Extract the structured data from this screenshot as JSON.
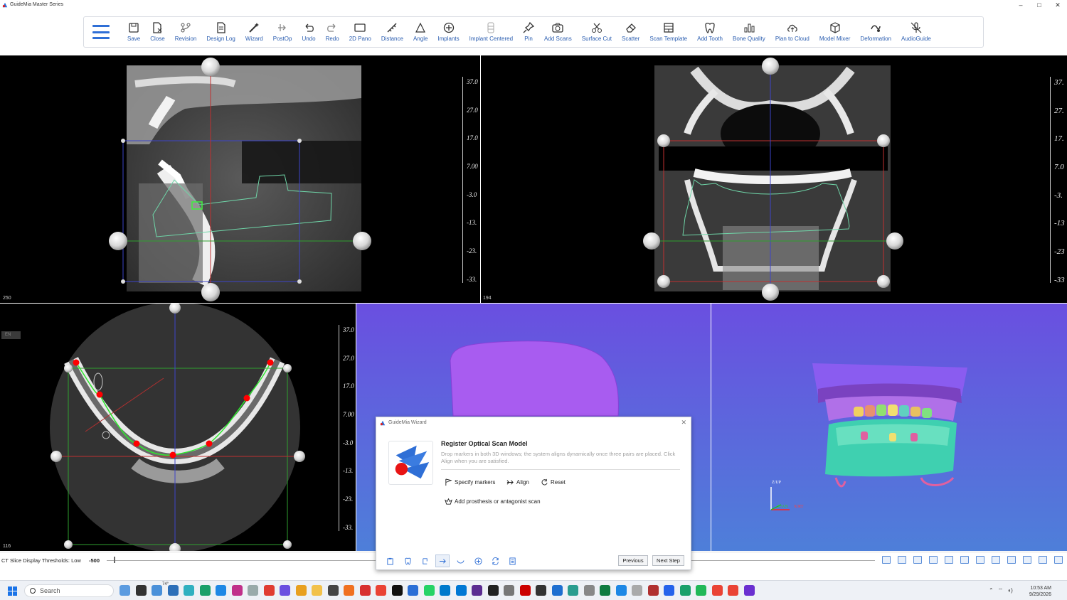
{
  "app": {
    "title": "GuideMia Master Series",
    "window_buttons": [
      "–",
      "□",
      "✕"
    ]
  },
  "toolbar": {
    "items": [
      {
        "label": "Save",
        "icon": "save-icon"
      },
      {
        "label": "Close",
        "icon": "close-file-icon"
      },
      {
        "label": "Revision",
        "icon": "revision-icon"
      },
      {
        "label": "Design Log",
        "icon": "document-icon"
      },
      {
        "label": "Wizard",
        "icon": "wand-icon"
      },
      {
        "label": "PostOp",
        "icon": "postop-icon"
      },
      {
        "label": "Undo",
        "icon": "undo-icon"
      },
      {
        "label": "Redo",
        "icon": "redo-icon"
      },
      {
        "label": "2D Pano",
        "icon": "pano-icon"
      },
      {
        "label": "Distance",
        "icon": "ruler-icon"
      },
      {
        "label": "Angle",
        "icon": "angle-icon"
      },
      {
        "label": "Implants",
        "icon": "implant-icon"
      },
      {
        "label": "Implant Centered",
        "icon": "implant-centered-icon"
      },
      {
        "label": "Pin",
        "icon": "pin-icon"
      },
      {
        "label": "Add Scans",
        "icon": "camera-icon"
      },
      {
        "label": "Surface Cut",
        "icon": "scissors-icon"
      },
      {
        "label": "Scatter",
        "icon": "eraser-icon"
      },
      {
        "label": "Scan Template",
        "icon": "template-icon"
      },
      {
        "label": "Add Tooth",
        "icon": "tooth-icon"
      },
      {
        "label": "Bone Quality",
        "icon": "bar-chart-icon"
      },
      {
        "label": "Plan to Cloud",
        "icon": "cloud-upload-icon"
      },
      {
        "label": "Model Mixer",
        "icon": "cube-icon"
      },
      {
        "label": "Deformation",
        "icon": "deformation-icon"
      },
      {
        "label": "AudioGuide",
        "icon": "mute-mic-icon"
      }
    ]
  },
  "viewports": {
    "sagittal": {
      "slice": "250",
      "ruler": [
        "37.0",
        "27.0",
        "17.0",
        "7.00",
        "-3.0",
        "-13.",
        "-23.",
        "-33."
      ]
    },
    "coronal": {
      "slice": "194",
      "ruler": [
        "37.",
        "27.",
        "17.",
        "7.0",
        "-3.",
        "-13",
        "-23",
        "-33"
      ]
    },
    "axial": {
      "slice": "116",
      "ruler": [
        "37.0",
        "27.0",
        "17.0",
        "7.00",
        "-3.0",
        "-13.",
        "-23.",
        "-33."
      ],
      "side_tag": "EN"
    },
    "model3d": {
      "axis_up": "Z/UP",
      "axis_x": "X/RT",
      "axis_y": "Y/AN"
    }
  },
  "dialog": {
    "window_title": "GuideMia Wizard",
    "heading": "Register Optical Scan Model",
    "description": "Drop markers in both 3D windows; the system aligns dynamically once three pairs are placed. Click Align when you are satisfied.",
    "actions": {
      "specify_markers": "Specify markers",
      "align": "Align",
      "reset": "Reset",
      "add_prosthesis": "Add prosthesis or antagonist scan"
    },
    "buttons": {
      "previous": "Previous",
      "next": "Next Step"
    }
  },
  "threshold_bar": {
    "label": "CT Slice Display Thresholds: Low",
    "low_value": "-500"
  },
  "taskbar": {
    "search_placeholder": "Search",
    "weather_temp": "74°",
    "time": "10:53 AM",
    "date": "9/29/2026"
  },
  "colors": {
    "accent": "#2f6fd6",
    "viewport_bg": "#000000",
    "model_bg_top": "#6a4fe0",
    "model_bg_bottom": "#4e7fd9",
    "marker_red": "#ff0000",
    "curve_green": "#29e029"
  }
}
